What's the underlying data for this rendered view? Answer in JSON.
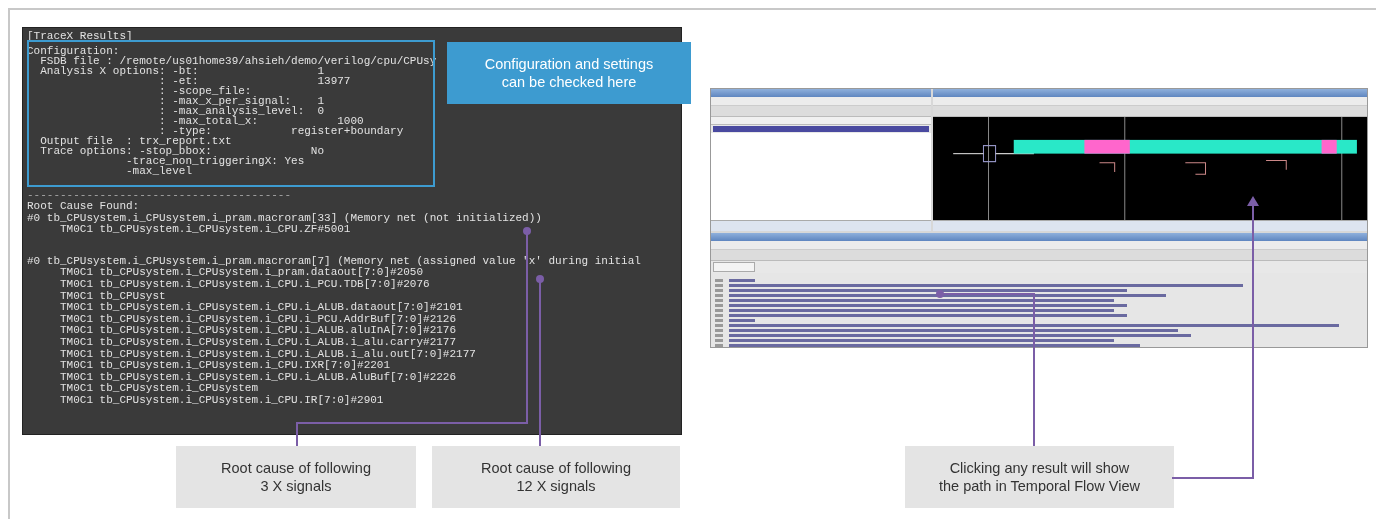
{
  "terminal": {
    "title": "[TraceX Results]",
    "blocks": [
      {
        "kind": "config",
        "lines": [
          "Configuration:",
          "  FSDB file : /remote/us01home39/ahsieh/demo/verilog/cpu/CPUsy",
          "  Analysis X options: -bt:                  1",
          "                    : -et:                  13977",
          "                    : -scope_file:",
          "                    : -max_x_per_signal:    1",
          "                    : -max_analysis_level:  0",
          "                    : -max_total_x:            1000",
          "                    : -type:            register+boundary",
          "  Output file  : trx_report.txt",
          "  Trace options: -stop_bbox:               No",
          "               -trace_non_triggeringX: Yes",
          "               -max_level"
        ]
      },
      {
        "kind": "separator",
        "lines": [
          "----------------------------------------"
        ]
      },
      {
        "kind": "result",
        "lines": [
          "Root Cause Found:",
          "#0 tb_CPUsystem.i_CPUsystem.i_pram.macroram[33] (Memory net (not initialized))",
          "     TM0C1 tb_CPUsystem.i_CPUsystem.i_CPU.ZF#5001"
        ]
      },
      {
        "kind": "result",
        "lines": [
          "#0 tb_CPUsystem.i_CPUsystem.i_pram.macroram[7] (Memory net (assigned value 'x' during initial",
          "     TM0C1 tb_CPUsystem.i_CPUsystem.i_pram.dataout[7:0]#2050",
          "     TM0C1 tb_CPUsystem.i_CPUsystem.i_CPU.i_PCU.TDB[7:0]#2076",
          "     TM0C1 tb_CPUsyst",
          "     TM0C1 tb_CPUsystem.i_CPUsystem.i_CPU.i_ALUB.dataout[7:0]#2101",
          "     TM0C1 tb_CPUsystem.i_CPUsystem.i_CPU.i_PCU.AddrBuf[7:0]#2126",
          "     TM0C1 tb_CPUsystem.i_CPUsystem.i_CPU.i_ALUB.aluInA[7:0]#2176",
          "     TM0C1 tb_CPUsystem.i_CPUsystem.i_CPU.i_ALUB.i_alu.carry#2177",
          "     TM0C1 tb_CPUsystem.i_CPUsystem.i_CPU.i_ALUB.i_alu.out[7:0]#2177",
          "     TM0C1 tb_CPUsystem.i_CPUsystem.i_CPU.IXR[7:0]#2201",
          "     TM0C1 tb_CPUsystem.i_CPUsystem.i_CPU.i_ALUB.AluBuf[7:0]#2226",
          "     TM0C1 tb_CPUsystem.i_CPUsystem",
          "     TM0C1 tb_CPUsystem.i_CPUsystem.i_CPU.IR[7:0]#2901"
        ]
      }
    ]
  },
  "callouts": [
    {
      "kind": "info",
      "text": "Configuration and settings\ncan be checked here"
    },
    {
      "kind": "note",
      "text": "Root cause of following\n3 X signals"
    },
    {
      "kind": "note",
      "text": "Root cause of following\n12 X signals"
    },
    {
      "kind": "note",
      "text": "Clicking any result will show\nthe path in Temporal Flow View"
    }
  ]
}
